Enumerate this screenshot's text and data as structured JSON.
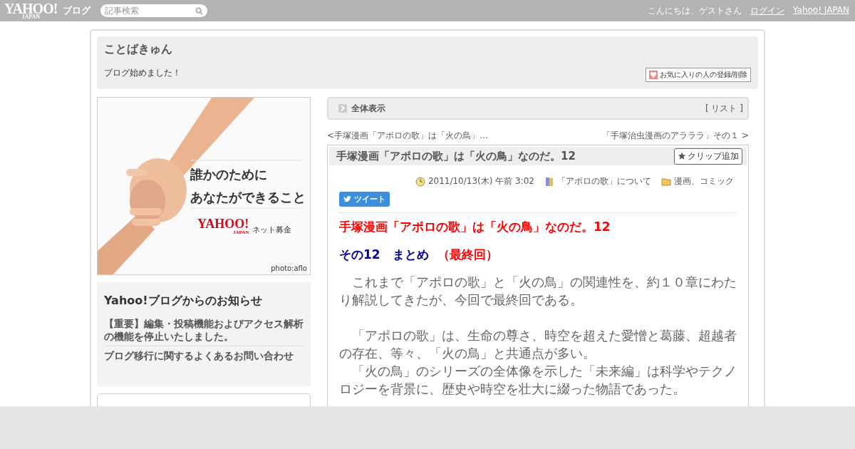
{
  "topbar": {
    "logo": "YAHOO!",
    "logo_sub": "JAPAN",
    "service": "ブログ",
    "search": {
      "placeholder": "記事検索"
    },
    "greeting": "こんにちは、ゲストさん",
    "links": [
      "ログイン",
      "Yahoo! JAPAN"
    ]
  },
  "blog": {
    "title": "ことばきゅん",
    "description": "ブログ始めました！",
    "favorite_button": "お気に入りの人の登録/削除"
  },
  "banner": {
    "kind": "picture",
    "lines": [
      "誰かのために",
      "あなたができること"
    ],
    "logo": "YAHOO!",
    "logo_sub": "JAPAN",
    "caption": "ネット募金",
    "credit": "photo:aflo"
  },
  "notice": {
    "title": "Yahoo!ブログからのお知らせ",
    "links": [
      "【重要】編集・投稿機能およびアクセス解析の機能を停止いたしました。",
      "ブログ移行に関するよくあるお問い合わせ"
    ]
  },
  "view_bar": {
    "label": "全体表示",
    "list_open": "[",
    "list_link": "リスト",
    "list_close": "]"
  },
  "pager": {
    "prev_mark": "<",
    "next_mark": ">",
    "prev": "手塚漫画「アポロの歌」は「火の鳥」…",
    "next": "「手塚治虫漫画のアラララ」その１"
  },
  "post": {
    "title": "手塚漫画「アポロの歌」は「火の鳥」なのだ。12",
    "clip_button": "クリップ追加",
    "date": "2011/10/13(木) 午前 3:02",
    "category": "「アポロの歌」について",
    "folder": "漫画、コミック",
    "tweet_button": "ツイート",
    "heading": "手塚漫画「アポロの歌」は「火の鳥」なのだ。12",
    "subheading": [
      {
        "text": "その12　まとめ",
        "color": "#000099"
      },
      {
        "text": "（最終回）",
        "color": "#ff0000"
      }
    ],
    "paragraphs": [
      [
        "　これまで「アポロの歌」と「火の鳥」の関連性を、約１０章にわたり解説してきたが、今回で最終回である。"
      ],
      [
        "　「アポロの歌」は、生命の尊さ、時空を超えた愛憎と葛藤、超越者の存在、等々、「火の鳥」と共通点が多い。",
        "　「火の鳥」のシリーズの全体像を示した「未来編」は科学やテクノロジーを背景に、歴史や時空を壮大に綴った物語であった。"
      ]
    ]
  }
}
